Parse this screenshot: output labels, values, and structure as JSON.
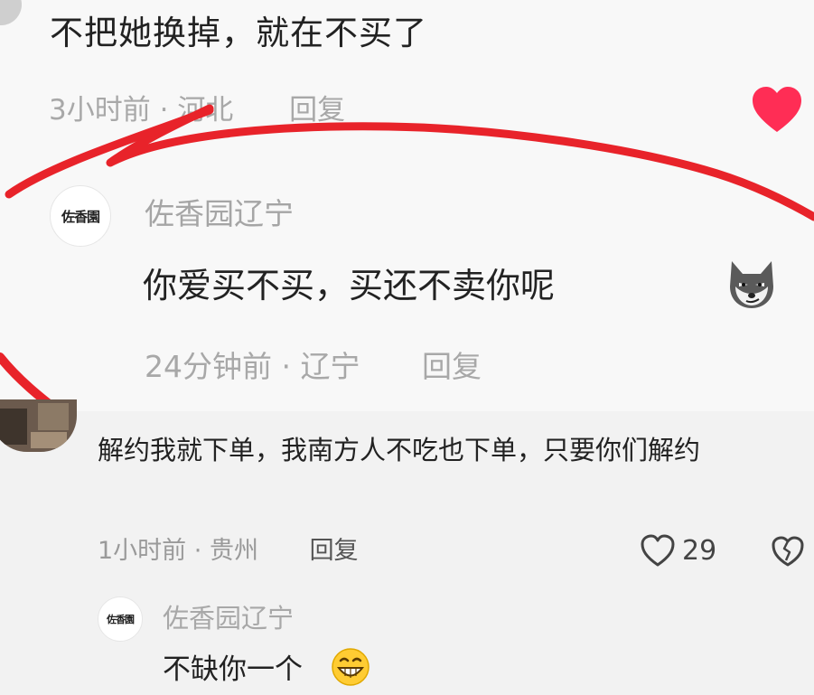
{
  "comment1": {
    "text": "不把她换掉，就在不买了",
    "time": "3小时前",
    "separator": "·",
    "location": "河北",
    "reply_label": "回复",
    "liked_icon": "heart-filled-icon",
    "like_color": "#ff2d55"
  },
  "reply1": {
    "avatar_text": "佐香園",
    "username": "佐香园辽宁",
    "text": "你爱买不买，买还不卖你呢",
    "emoji": "wolf-smirk-emoji",
    "time": "24分钟前",
    "separator": "·",
    "location": "辽宁",
    "reply_label": "回复"
  },
  "comment2": {
    "text": "解约我就下单，我南方人不吃也下单，只要你们解约",
    "time": "1小时前",
    "separator": "·",
    "location": "贵州",
    "reply_label": "回复",
    "like_count": "29"
  },
  "reply2": {
    "avatar_text": "佐香園",
    "username": "佐香园辽宁",
    "text": "不缺你一个",
    "emoji": "grinning-emoji"
  },
  "annotation": {
    "color": "#e8232a",
    "type": "hand-drawn-underline"
  }
}
